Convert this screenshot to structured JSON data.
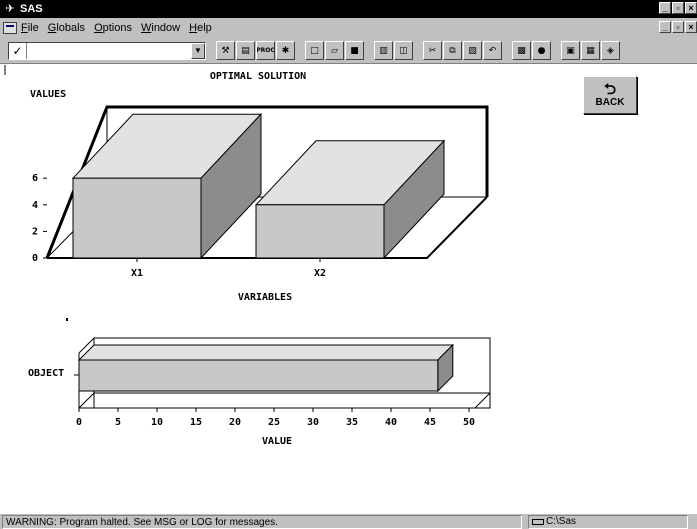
{
  "window": {
    "title": "SAS"
  },
  "menu": [
    {
      "label": "File"
    },
    {
      "label": "Globals"
    },
    {
      "label": "Options"
    },
    {
      "label": "Window"
    },
    {
      "label": "Help"
    }
  ],
  "toolbar": {
    "command_value": "",
    "check_icon": "check-icon",
    "buttons_group1": [
      "tool-a-icon",
      "tool-b-icon",
      "proc-icon",
      "run-icon"
    ],
    "proc_label": "PROC",
    "buttons_group2": [
      "new-icon",
      "open-icon",
      "save-icon",
      "print-icon",
      "preview-icon",
      "cut-icon",
      "copy-icon",
      "paste-icon",
      "undo-icon",
      "tool-c-icon",
      "tool-d-icon",
      "tool-e-icon",
      "tool-f-icon",
      "tool-g-icon"
    ]
  },
  "back_button": {
    "label": "BACK",
    "icon": "back-arrow-icon"
  },
  "chart_data": [
    {
      "type": "bar",
      "title": "OPTIMAL SOLUTION",
      "ylabel": "VALUES",
      "xlabel": "VARIABLES",
      "categories": [
        "X1",
        "X2"
      ],
      "values": [
        6,
        4
      ],
      "yticks": [
        "0",
        "2",
        "4",
        "6"
      ],
      "ylim": [
        0,
        8
      ],
      "style": "3d",
      "bar_color": "#c8c8c8"
    },
    {
      "type": "bar",
      "orientation": "horizontal",
      "ylabel": "OBJECT",
      "xlabel": "VALUE",
      "categories": [
        "OBJECT"
      ],
      "values": [
        46
      ],
      "xticks": [
        "0",
        "5",
        "10",
        "15",
        "20",
        "25",
        "30",
        "35",
        "40",
        "45",
        "50"
      ],
      "xlim": [
        0,
        50
      ],
      "style": "3d",
      "bar_color": "#c8c8c8"
    }
  ],
  "status": {
    "message": "WARNING: Program halted. See MSG or LOG for messages.",
    "path": "C:\\Sas"
  }
}
